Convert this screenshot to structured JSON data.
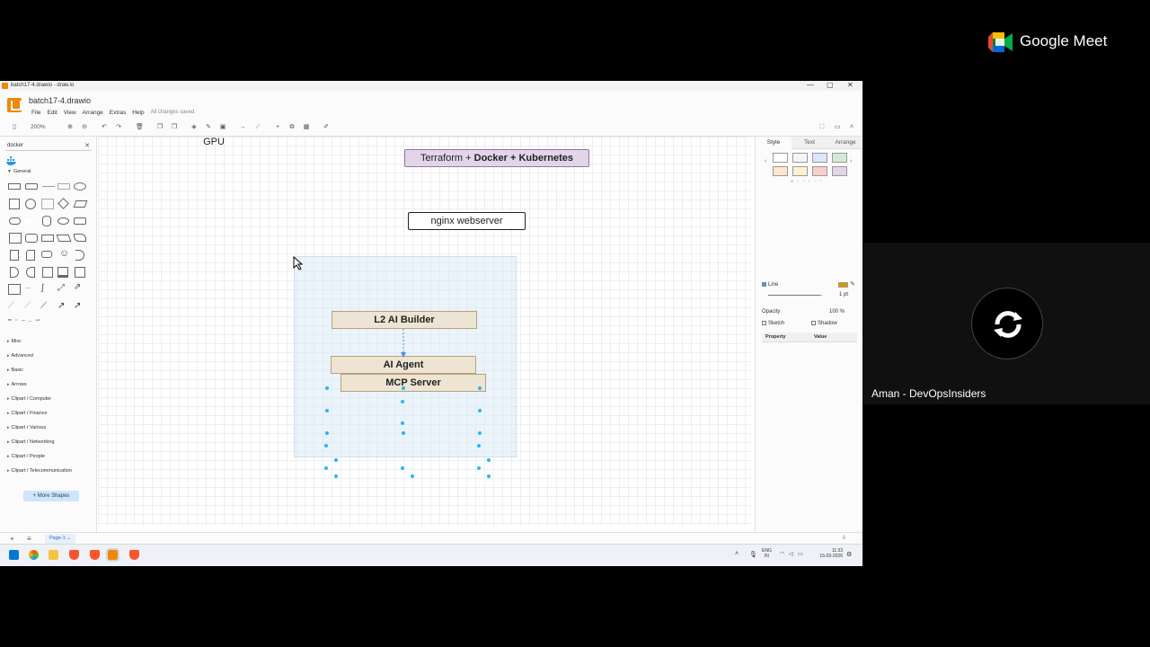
{
  "window": {
    "title": "batch17-4.drawio - draw.io",
    "min": "—",
    "max": "▢",
    "close": "✕"
  },
  "app": {
    "doc_name": "batch17-4.drawio",
    "menu": [
      "File",
      "Edit",
      "View",
      "Arrange",
      "Extras",
      "Help"
    ],
    "save_status": "All changes saved"
  },
  "toolbar": {
    "zoom": "200%"
  },
  "sidebar": {
    "search_value": "docker",
    "search_clear": "✕",
    "general": "General",
    "sections": [
      "Misc",
      "Advanced",
      "Basic",
      "Arrows",
      "Clipart / Computer",
      "Clipart / Finance",
      "Clipart / Various",
      "Clipart / Networking",
      "Clipart / People",
      "Clipart / Telecommunication"
    ],
    "more_shapes": "+ More Shapes"
  },
  "canvas": {
    "gpu_label": "GPU",
    "terraform_prefix": "Terraform + ",
    "terraform_bold": "Docker + Kubernetes",
    "nginx": "nginx webserver",
    "l2": "L2 AI Builder",
    "agent": "AI Agent",
    "mcp": "MCP Server"
  },
  "format_panel": {
    "tabs": [
      "Style",
      "Text",
      "Arrange"
    ],
    "line_label": "Line",
    "line_width": "1 pt",
    "opacity_label": "Opacity",
    "opacity_value": "100 %",
    "sketch": "Sketch",
    "shadow": "Shadow",
    "property_header": "Property",
    "value_header": "Value"
  },
  "pagebar": {
    "page": "Page-1"
  },
  "taskbar": {
    "lang_top": "ENG",
    "lang_bottom": "IN",
    "time": "11:33",
    "date": "15-03-2026"
  },
  "meet": {
    "brand": "Google Meet",
    "participant": "Aman - DevOpsInsiders"
  }
}
